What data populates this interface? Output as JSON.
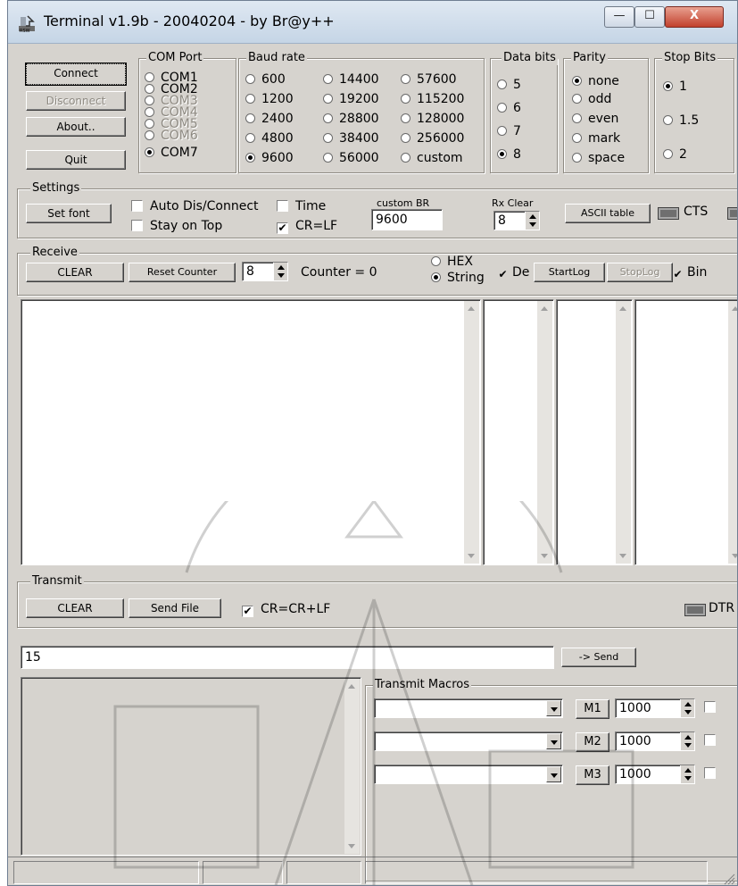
{
  "window": {
    "title": "Terminal v1.9b - 20040204 - by Br@y++",
    "close_symbol": "X",
    "minimize_symbol": "—",
    "maximize_symbol": "☐"
  },
  "buttons": {
    "connect": "Connect",
    "disconnect": "Disconnect",
    "about": "About..",
    "quit": "Quit"
  },
  "com_port": {
    "label": "COM Port",
    "options": [
      "COM1",
      "COM2",
      "COM3",
      "COM4",
      "COM5",
      "COM6",
      "COM7"
    ],
    "selected": "COM7"
  },
  "baud_rate": {
    "label": "Baud rate",
    "col1": [
      "600",
      "1200",
      "2400",
      "4800",
      "9600"
    ],
    "col2": [
      "14400",
      "19200",
      "28800",
      "38400",
      "56000"
    ],
    "col3": [
      "57600",
      "115200",
      "128000",
      "256000",
      "custom"
    ],
    "selected": "9600"
  },
  "data_bits": {
    "label": "Data bits",
    "options": [
      "5",
      "6",
      "7",
      "8"
    ],
    "selected": "8"
  },
  "parity": {
    "label": "Parity",
    "options": [
      "none",
      "odd",
      "even",
      "mark",
      "space"
    ],
    "selected": "none"
  },
  "stop_bits": {
    "label": "Stop Bits",
    "options": [
      "1",
      "1.5",
      "2"
    ],
    "selected": "1"
  },
  "settings": {
    "label": "Settings",
    "set_font": "Set font",
    "auto_dis_connect": "Auto Dis/Connect",
    "stay_on_top": "Stay on Top",
    "time": "Time",
    "cr_lf": "CR=LF",
    "custom_br_label": "custom BR",
    "custom_br_value": "9600",
    "rx_clear_label": "Rx Clear",
    "rx_clear_value": "8",
    "ascii_table": "ASCII table",
    "cts": "CTS"
  },
  "receive": {
    "label": "Receive",
    "clear": "CLEAR",
    "reset_counter": "Reset Counter",
    "counter_spin": "8",
    "counter_text": "Counter = 0",
    "hex": "HEX",
    "string": "String",
    "selected_format": "String",
    "dec": "De",
    "start_log": "StartLog",
    "stop_log": "StopLog",
    "bin": "Bin"
  },
  "transmit": {
    "label": "Transmit",
    "clear": "CLEAR",
    "send_file": "Send File",
    "cr_crlf": "CR=CR+LF",
    "dtr": "DTR",
    "input_value": "15",
    "send": "-> Send"
  },
  "macros": {
    "label": "Transmit Macros",
    "items": [
      {
        "name": "M1",
        "interval": "1000"
      },
      {
        "name": "M2",
        "interval": "1000"
      },
      {
        "name": "M3",
        "interval": "1000"
      }
    ]
  }
}
